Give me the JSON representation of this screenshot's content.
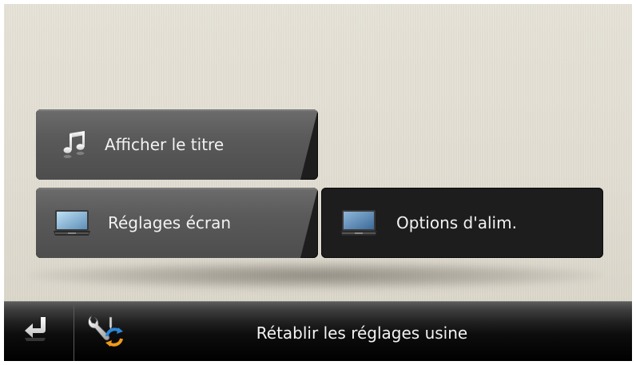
{
  "menu": {
    "items": [
      {
        "id": "afficher",
        "label": "Afficher le titre",
        "icon": "music-note-icon"
      },
      {
        "id": "reglages",
        "label": "Réglages écran",
        "icon": "monitor-icon"
      },
      {
        "id": "options",
        "label": "Options d'alim.",
        "icon": "power-moon-monitor-icon"
      }
    ]
  },
  "bottom_bar": {
    "back_icon": "back-arrow-icon",
    "reset_icon": "wrench-refresh-icon",
    "reset_label": "Rétablir les réglages usine"
  },
  "colors": {
    "background": "#e2ded3",
    "button_dark": "#1d1d1d",
    "button_face": "#5a5a5a",
    "text": "#f2f2f2",
    "bar": "#0d0d0d"
  }
}
